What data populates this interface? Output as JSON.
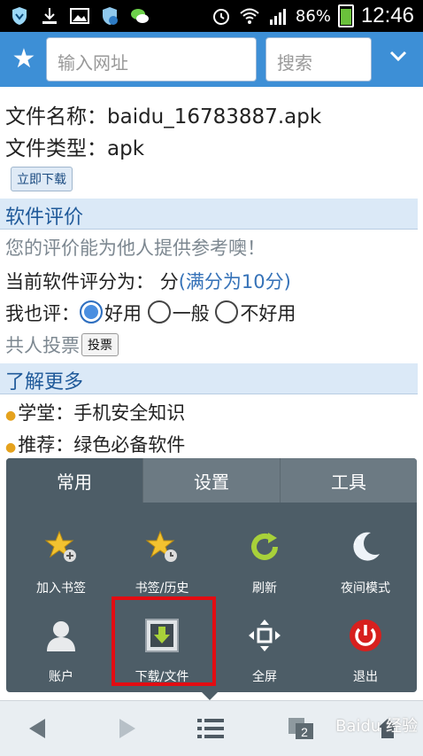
{
  "status_bar": {
    "battery": "86%",
    "time": "12:46"
  },
  "address_bar": {
    "url_placeholder": "输入网址",
    "search_placeholder": "搜索"
  },
  "content": {
    "file_name_label": "文件名称：baidu_16783887.apk",
    "file_type_label": "文件类型：apk",
    "download_now": "立即下载",
    "review_section": "软件评价",
    "review_hint": "您的评价能为他人提供参考噢！",
    "current_score_prefix": "当前软件评分为：",
    "current_score_unit": "分",
    "current_score_max": "(满分为10分)",
    "rate_prefix": "我也评：",
    "rate_options": [
      "好用",
      "一般",
      "不好用"
    ],
    "votes_text": "共人投票",
    "vote_button": "投票",
    "more_section": "了解更多",
    "links": [
      "学堂：手机安全知识",
      "推荐：绿色必备软件"
    ]
  },
  "menu": {
    "tabs": [
      "常用",
      "设置",
      "工具"
    ],
    "items": [
      {
        "label": "加入书签",
        "icon": "star-add-icon"
      },
      {
        "label": "书签/历史",
        "icon": "star-clock-icon"
      },
      {
        "label": "刷新",
        "icon": "refresh-icon"
      },
      {
        "label": "夜间模式",
        "icon": "moon-icon"
      },
      {
        "label": "账户",
        "icon": "user-icon"
      },
      {
        "label": "下载/文件",
        "icon": "download-icon"
      },
      {
        "label": "全屏",
        "icon": "fullscreen-icon"
      },
      {
        "label": "退出",
        "icon": "power-icon"
      }
    ]
  },
  "bottom_bar": {
    "window_count": "2",
    "watermark": "Baidu 经验"
  },
  "colors": {
    "address_bar": "#3d8fd6",
    "menu_bg": "#4d5d67",
    "highlight": "#e30c12"
  }
}
